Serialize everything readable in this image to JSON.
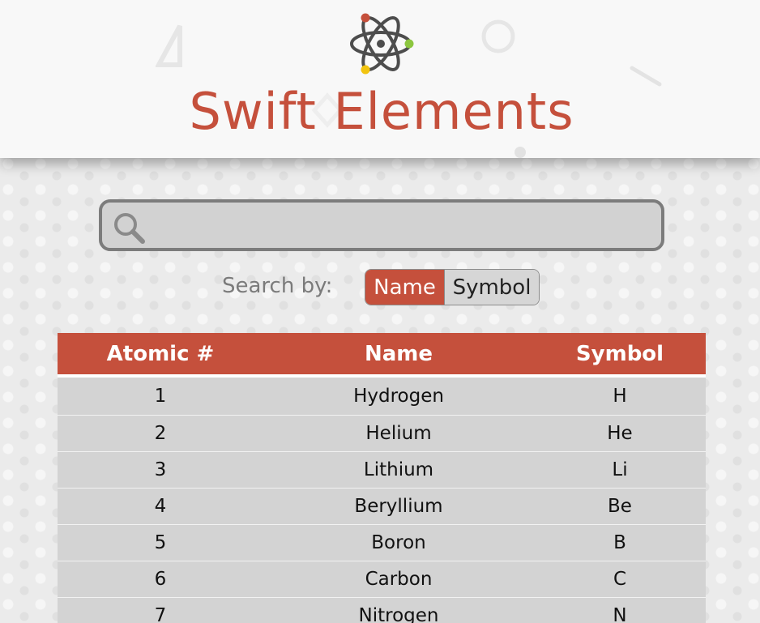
{
  "header": {
    "title": "Swift Elements",
    "logo_icon": "atom-icon",
    "colors": {
      "accent": "#c5503c",
      "orbit": "#4a4a4a",
      "dot_red": "#c5503c",
      "dot_green": "#8cc63f",
      "dot_yellow": "#f2c40f"
    }
  },
  "search": {
    "icon": "search-icon",
    "value": "",
    "placeholder": ""
  },
  "search_by": {
    "label": "Search by:",
    "options": [
      "Name",
      "Symbol"
    ],
    "selected": "Name"
  },
  "table": {
    "headers": [
      "Atomic #",
      "Name",
      "Symbol"
    ],
    "rows": [
      [
        "1",
        "Hydrogen",
        "H"
      ],
      [
        "2",
        "Helium",
        "He"
      ],
      [
        "3",
        "Lithium",
        "Li"
      ],
      [
        "4",
        "Beryllium",
        "Be"
      ],
      [
        "5",
        "Boron",
        "B"
      ],
      [
        "6",
        "Carbon",
        "C"
      ],
      [
        "7",
        "Nitrogen",
        "N"
      ]
    ]
  }
}
